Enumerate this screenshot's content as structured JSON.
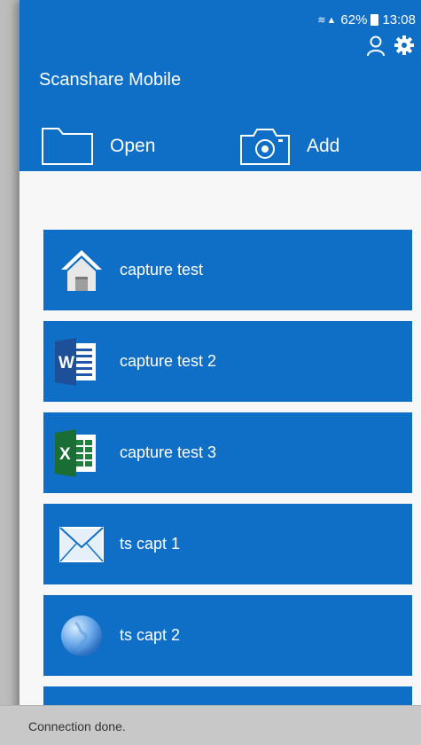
{
  "status_bar": {
    "battery": "62%",
    "time": "13:08"
  },
  "app": {
    "title": "Scanshare Mobile"
  },
  "actions": {
    "open_label": "Open",
    "add_label": "Add"
  },
  "items": [
    {
      "label": "capture test",
      "icon": "home-icon"
    },
    {
      "label": "capture test 2",
      "icon": "word-icon"
    },
    {
      "label": "capture test 3",
      "icon": "excel-icon"
    },
    {
      "label": "ts capt 1",
      "icon": "mail-icon"
    },
    {
      "label": "ts capt 2",
      "icon": "globe-icon"
    }
  ],
  "toast": {
    "message": "Connection done."
  },
  "colors": {
    "brand": "#0f6fc6",
    "background": "#f7f7f7"
  }
}
